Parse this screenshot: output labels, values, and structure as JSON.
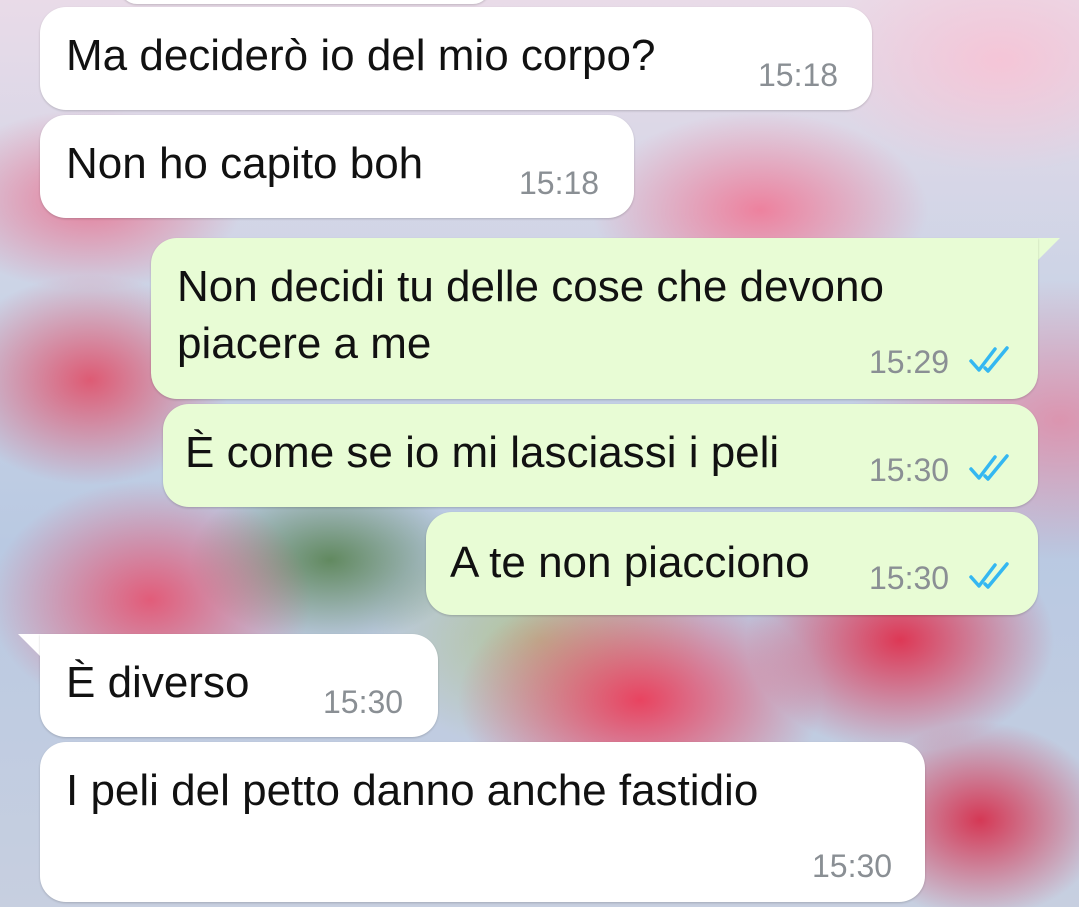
{
  "colors": {
    "incoming_bubble": "#ffffff",
    "outgoing_bubble": "#e8fcd5",
    "timestamp": "#8a8f94",
    "read_ticks": "#34b7f1"
  },
  "messages": [
    {
      "direction": "incoming",
      "text": "Ma deciderò io del mio corpo?",
      "time": "15:18"
    },
    {
      "direction": "incoming",
      "text": "Non ho capito boh",
      "time": "15:18"
    },
    {
      "direction": "outgoing",
      "text_line1": "Non decidi tu delle cose che devono",
      "text_line2": "piacere a me",
      "time": "15:29",
      "status_icon": "double-check-read-icon"
    },
    {
      "direction": "outgoing",
      "text": "È come se io mi lasciassi i peli",
      "time": "15:30",
      "status_icon": "double-check-read-icon"
    },
    {
      "direction": "outgoing",
      "text": "A te non piacciono",
      "time": "15:30",
      "status_icon": "double-check-read-icon"
    },
    {
      "direction": "incoming",
      "text": "È diverso",
      "time": "15:30"
    },
    {
      "direction": "incoming",
      "text": "I peli del petto danno anche fastidio",
      "time": "15:30"
    }
  ]
}
